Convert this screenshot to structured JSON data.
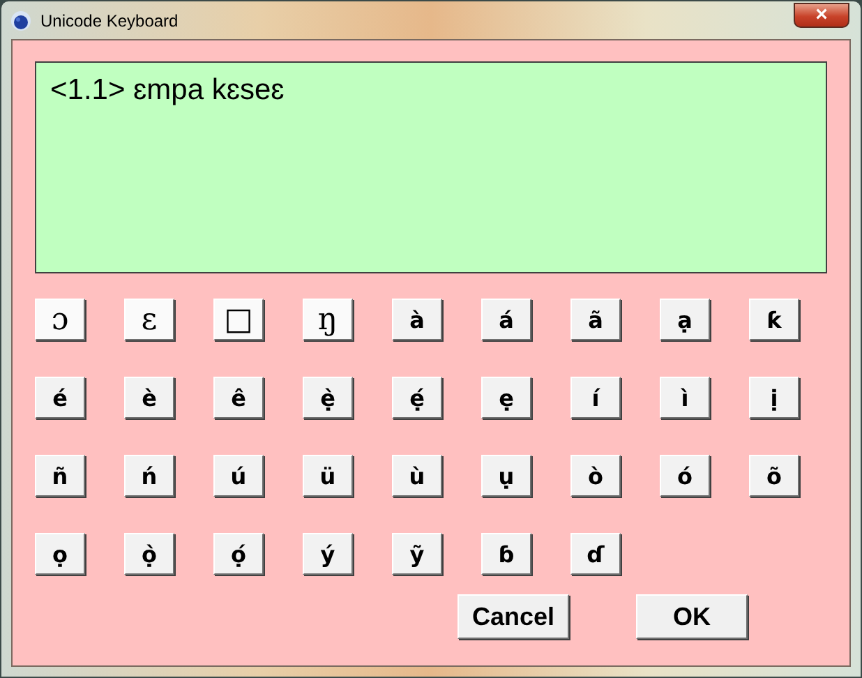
{
  "window": {
    "title": "Unicode Keyboard",
    "close": "×"
  },
  "text_area": {
    "value": "<1.1> ɛmpa kɛseɛ"
  },
  "keys": [
    [
      "ɔ",
      "ɛ",
      "□",
      "ŋ",
      "à",
      "á",
      "ã",
      "ạ",
      "ƙ"
    ],
    [
      "é",
      "è",
      "ê",
      "ẹ̀",
      "ẹ́",
      "ẹ",
      "í",
      "ì",
      "ị"
    ],
    [
      "ñ",
      "ń",
      "ú",
      "ü",
      "ù",
      "ụ",
      "ò",
      "ó",
      "õ"
    ],
    [
      "ọ",
      "ọ̀",
      "ọ́",
      "ý",
      "ỹ",
      "ɓ",
      "ɗ"
    ]
  ],
  "buttons": [
    "Cancel",
    "OK"
  ]
}
